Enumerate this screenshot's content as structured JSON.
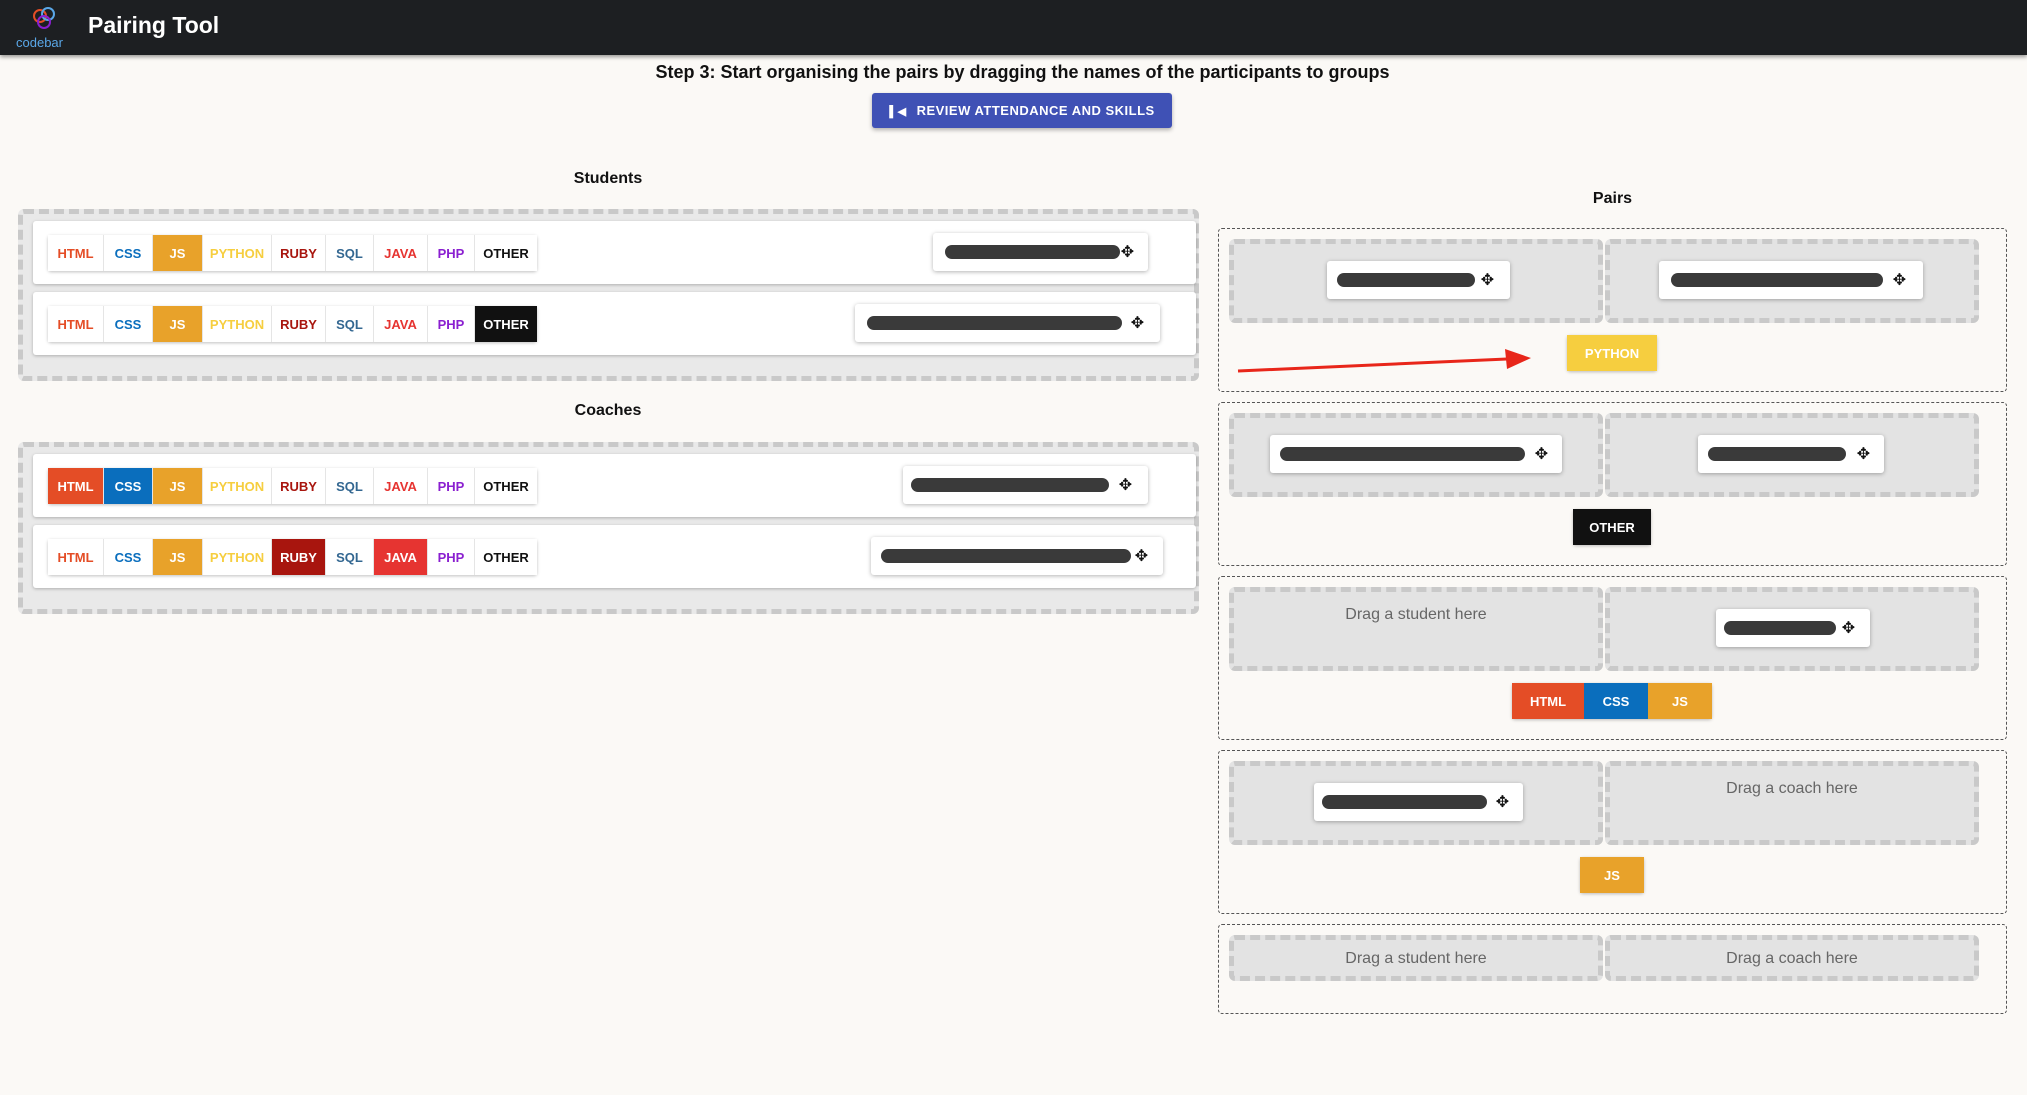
{
  "header": {
    "logo_text": "codebar",
    "title": "Pairing Tool"
  },
  "step_title": "Step 3: Start organising the pairs by dragging the names of the participants to groups",
  "review_button": {
    "label": "REVIEW ATTENDANCE AND SKILLS",
    "icon": "skip-previous-icon"
  },
  "students_title": "Students",
  "coaches_title": "Coaches",
  "pairs_title": "Pairs",
  "skill_labels": [
    "HTML",
    "CSS",
    "JS",
    "PYTHON",
    "RUBY",
    "SQL",
    "JAVA",
    "PHP",
    "OTHER"
  ],
  "colors": {
    "HTML": "#e44d26",
    "CSS": "#0a6ebd",
    "JS": "#e8a22a",
    "PYTHON": "#f6ce3f",
    "RUBY": "#a8150e",
    "SQL": "#336791",
    "JAVA": "#e63431",
    "PHP": "#8a1fd0",
    "OTHER": "#111111",
    "accent": "#3f51b5",
    "topbar": "#1d1f22",
    "arrow": "#e8261a"
  },
  "students": [
    {
      "active_skills": [
        "JS"
      ],
      "name_redacted": true
    },
    {
      "active_skills": [
        "JS",
        "OTHER"
      ],
      "name_redacted": true
    }
  ],
  "coaches": [
    {
      "active_skills": [
        "HTML",
        "CSS",
        "JS"
      ],
      "name_redacted": true
    },
    {
      "active_skills": [
        "JS",
        "RUBY",
        "JAVA"
      ],
      "name_redacted": true
    }
  ],
  "pairs": [
    {
      "student": "redacted",
      "coach": "redacted",
      "skills": [
        "PYTHON"
      ]
    },
    {
      "student": "redacted",
      "coach": "redacted",
      "skills": [
        "OTHER"
      ]
    },
    {
      "student_placeholder": "Drag a student here",
      "coach": "redacted",
      "skills": [
        "HTML",
        "CSS",
        "JS"
      ]
    },
    {
      "student": "redacted",
      "coach_placeholder": "Drag a coach here",
      "skills": [
        "JS"
      ]
    },
    {
      "student_placeholder": "Drag a student here",
      "coach_placeholder": "Drag a coach here",
      "skills": []
    }
  ]
}
